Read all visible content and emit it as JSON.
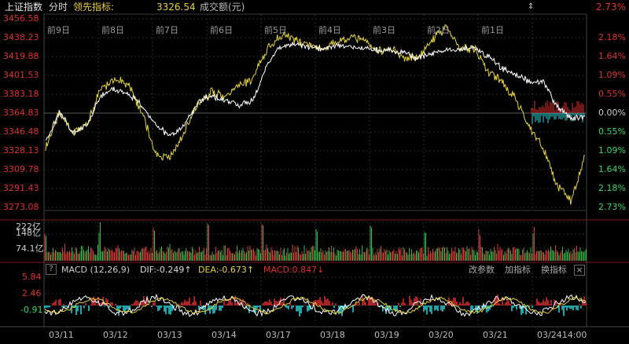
{
  "header": {
    "index_name": "上证指数",
    "mode": "分时",
    "leader_label": "领先指标:",
    "leader_value": "3326.54",
    "volume_label": "成交额(元)",
    "top_right_pct": "2.73%"
  },
  "price_axis": [
    "3456.58",
    "3438.23",
    "3419.88",
    "3401.53",
    "3383.18",
    "3364.83",
    "3346.48",
    "3328.13",
    "3309.78",
    "3291.43",
    "3273.08"
  ],
  "pct_axis": [
    "2.18%",
    "1.64%",
    "1.09%",
    "0.55%",
    "0.00%",
    "0.55%",
    "1.09%",
    "1.64%",
    "2.18%",
    "2.73%"
  ],
  "day_labels": [
    "前9日",
    "前8日",
    "前7日",
    "前6日",
    "前5日",
    "前4日",
    "前3日",
    "前2日",
    "前1日"
  ],
  "volume_axis": [
    "222亿",
    "148亿",
    "74.1亿"
  ],
  "macd": {
    "help": "?",
    "title": "MACD (12,26,9)",
    "dif": "DIF:-0.249↑",
    "dea": "DEA:-0.673↑",
    "macd": "MACD:0.847↓",
    "axis": [
      "5.84",
      "2.46",
      "-0.91"
    ],
    "btn_params": "改参数",
    "btn_add": "加指标",
    "btn_switch": "换指标",
    "close": "×"
  },
  "dates": [
    "03/11",
    "03/12",
    "03/13",
    "03/14",
    "03/17",
    "03/18",
    "03/19",
    "03/20",
    "03/21",
    "03/2414:00"
  ],
  "colors": {
    "up": "#e03030",
    "down": "#2fd9e0",
    "price": "#ffffff",
    "leader": "#e6d23a",
    "vol_up": "#d83b3b",
    "vol_down": "#3cb24a"
  },
  "chart_data": {
    "type": "line",
    "title": "上证指数",
    "xlabel": "",
    "ylabel": "",
    "ylim": [
      3273.08,
      3456.58
    ],
    "series": [
      {
        "name": "上证指数",
        "values": [
          3338,
          3366,
          3346,
          3353,
          3382,
          3388,
          3384,
          3371,
          3352,
          3343,
          3352,
          3375,
          3382,
          3378,
          3372,
          3377,
          3412,
          3430,
          3432,
          3430,
          3428,
          3431,
          3429,
          3428,
          3427,
          3425,
          3424,
          3418,
          3423,
          3425,
          3427,
          3428,
          3420,
          3408,
          3403,
          3395,
          3395,
          3371,
          3360,
          3362
        ]
      },
      {
        "name": "领先指标",
        "values": [
          3330,
          3366,
          3345,
          3354,
          3390,
          3397,
          3393,
          3364,
          3325,
          3322,
          3345,
          3375,
          3385,
          3382,
          3392,
          3398,
          3428,
          3440,
          3437,
          3431,
          3426,
          3435,
          3438,
          3438,
          3425,
          3427,
          3418,
          3419,
          3438,
          3447,
          3427,
          3428,
          3405,
          3395,
          3378,
          3350,
          3330,
          3294,
          3279,
          3322
        ]
      }
    ],
    "volume": {
      "ylim": [
        0,
        222
      ]
    },
    "macd_axis": [
      5.84,
      2.46,
      -0.91
    ]
  }
}
